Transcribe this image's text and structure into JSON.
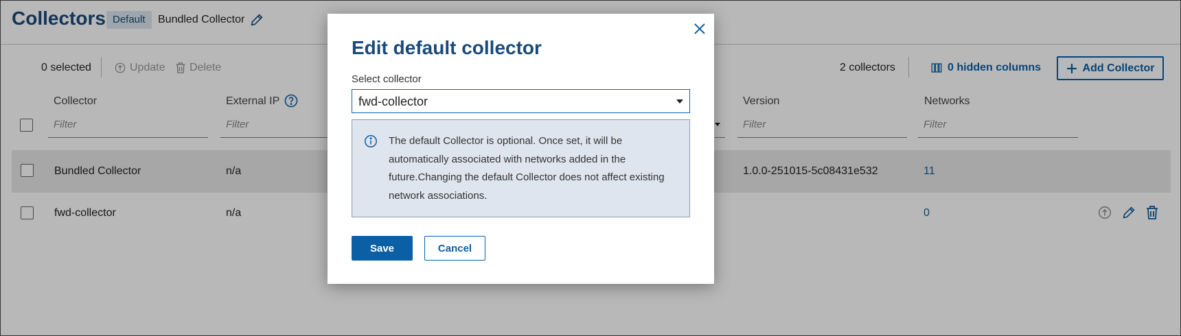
{
  "header": {
    "title": "Collectors",
    "default_badge": "Default",
    "default_name": "Bundled Collector"
  },
  "toolbar": {
    "selected": "0 selected",
    "update_label": "Update",
    "delete_label": "Delete",
    "count": "2 collectors",
    "hidden_columns": "0 hidden columns",
    "add_label": "Add Collector"
  },
  "table": {
    "columns": [
      "Collector",
      "External IP",
      "Version",
      "Networks"
    ],
    "filter_placeholder": "Filter",
    "rows": [
      {
        "collector": "Bundled Collector",
        "external_ip": "n/a",
        "version": "1.0.0-251015-5c08431e532",
        "networks": "11"
      },
      {
        "collector": "fwd-collector",
        "external_ip": "n/a",
        "version": "",
        "networks": "0"
      }
    ]
  },
  "modal": {
    "title": "Edit default collector",
    "select_label": "Select collector",
    "selected_value": "fwd-collector",
    "info_text": "The default Collector is optional. Once set, it will be automatically associated with networks added in the future.Changing the default Collector does not affect existing network associations.",
    "save_label": "Save",
    "cancel_label": "Cancel"
  },
  "colors": {
    "brand": "#0b5fa5",
    "title": "#1a4a7a",
    "info_bg": "#dee5ee"
  },
  "icons": [
    "pencil-icon",
    "update-icon",
    "trash-icon",
    "columns-icon",
    "plus-icon",
    "help-icon",
    "close-icon",
    "info-icon",
    "chevron-down-icon"
  ]
}
